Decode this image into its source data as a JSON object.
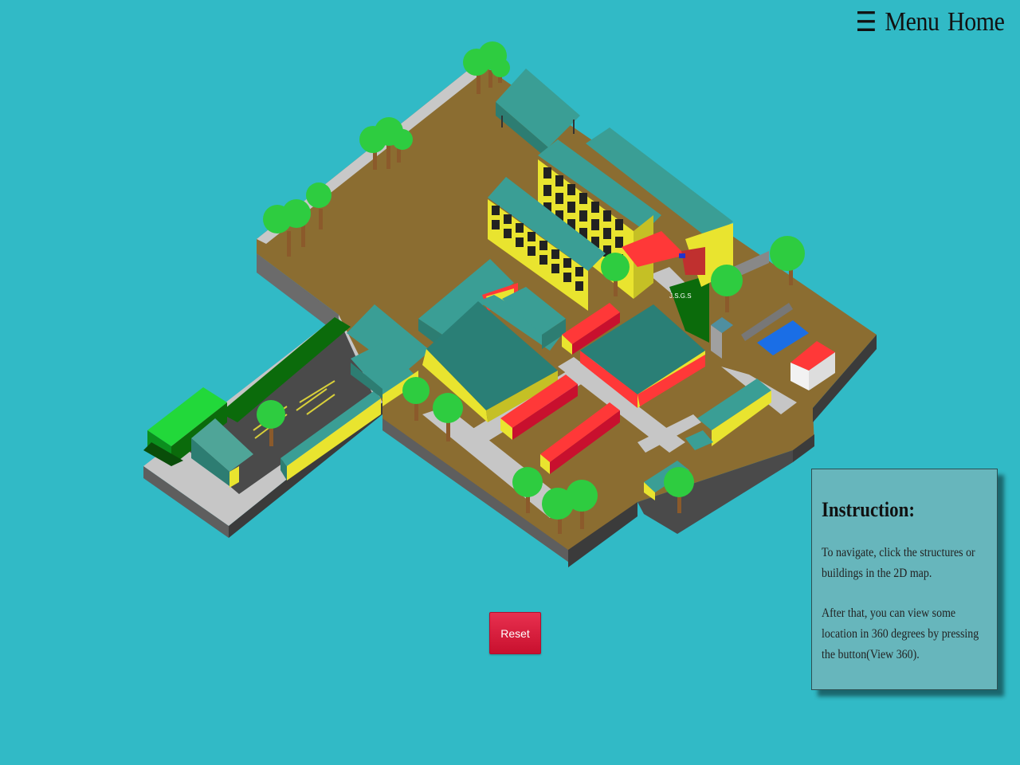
{
  "nav": {
    "menu_icon": "☰",
    "menu_label": "Menu",
    "home_label": "Home"
  },
  "map": {
    "flag_label": "J.S.G.S"
  },
  "reset": {
    "label": "Reset"
  },
  "instruction": {
    "title": "Instruction:",
    "paragraph1": "To navigate, click the structures or buildings in the 2D map.",
    "paragraph2": "After that, you can view some location in 360 degrees by pressing the button(View 360)."
  },
  "colors": {
    "background": "#31bac6",
    "ground": "#8b6d31",
    "path": "#c6c6c6",
    "roof": "#3a9e95",
    "wall_yellow": "#e9e42f",
    "red_building": "#ff3838",
    "tree": "#2ecc40",
    "reset_button": "#d81e3f",
    "panel": "#67b6bc"
  }
}
